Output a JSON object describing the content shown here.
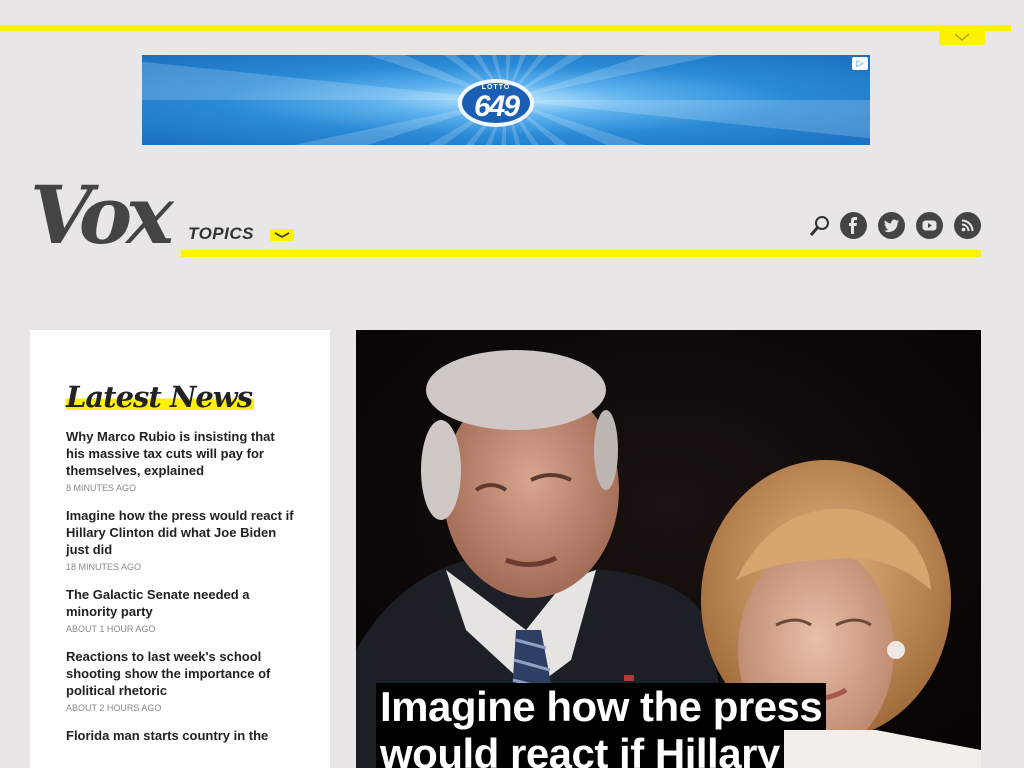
{
  "ad": {
    "logo_text": "LOTTO",
    "logo_number": "649"
  },
  "header": {
    "logo": "Vox",
    "topics_label": "TOPICS"
  },
  "icons": [
    "search-icon",
    "facebook-icon",
    "twitter-icon",
    "youtube-icon",
    "rss-icon"
  ],
  "colors": {
    "accent": "#fff200",
    "background": "#e8e6e6",
    "icon": "#444444"
  },
  "sidebar": {
    "heading": "Latest News",
    "items": [
      {
        "title": "Why Marco Rubio is insisting that his massive tax cuts will pay for themselves, explained",
        "time": "8 MINUTES AGO"
      },
      {
        "title": "Imagine how the press would react if Hillary Clinton did what Joe Biden just did",
        "time": "18 MINUTES AGO"
      },
      {
        "title": "The Galactic Senate needed a minority party",
        "time": "ABOUT 1 HOUR AGO"
      },
      {
        "title": "Reactions to last week's school shooting show the importance of political rhetoric",
        "time": "ABOUT 2 HOURS AGO"
      },
      {
        "title": "Florida man starts country in the",
        "time": ""
      }
    ]
  },
  "hero": {
    "title": "Imagine how the press would react if Hillary"
  }
}
